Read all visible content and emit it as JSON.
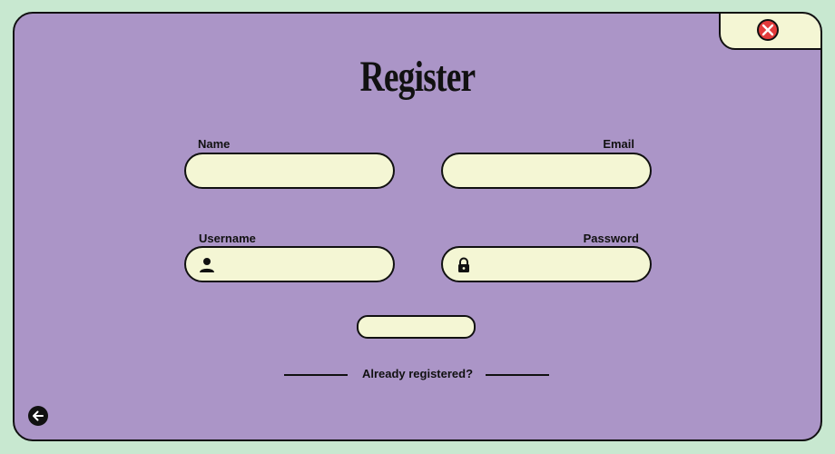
{
  "title": "Register",
  "fields": {
    "name": {
      "label": "Name",
      "value": "",
      "placeholder": ""
    },
    "email": {
      "label": "Email",
      "value": "",
      "placeholder": ""
    },
    "username": {
      "label": "Username",
      "value": "",
      "placeholder": "",
      "icon": "user-icon"
    },
    "password": {
      "label": "Password",
      "value": "",
      "placeholder": "",
      "icon": "lock-icon"
    }
  },
  "submit_label": "",
  "already_registered_label": "Already registered?",
  "icons": {
    "close": "close-icon",
    "back": "back-arrow-icon"
  },
  "colors": {
    "page_background": "#c8e8d0",
    "card_background": "#ab95c7",
    "field_background": "#f4f6d4",
    "close_button": "#e23a3a",
    "outline": "#111111"
  }
}
